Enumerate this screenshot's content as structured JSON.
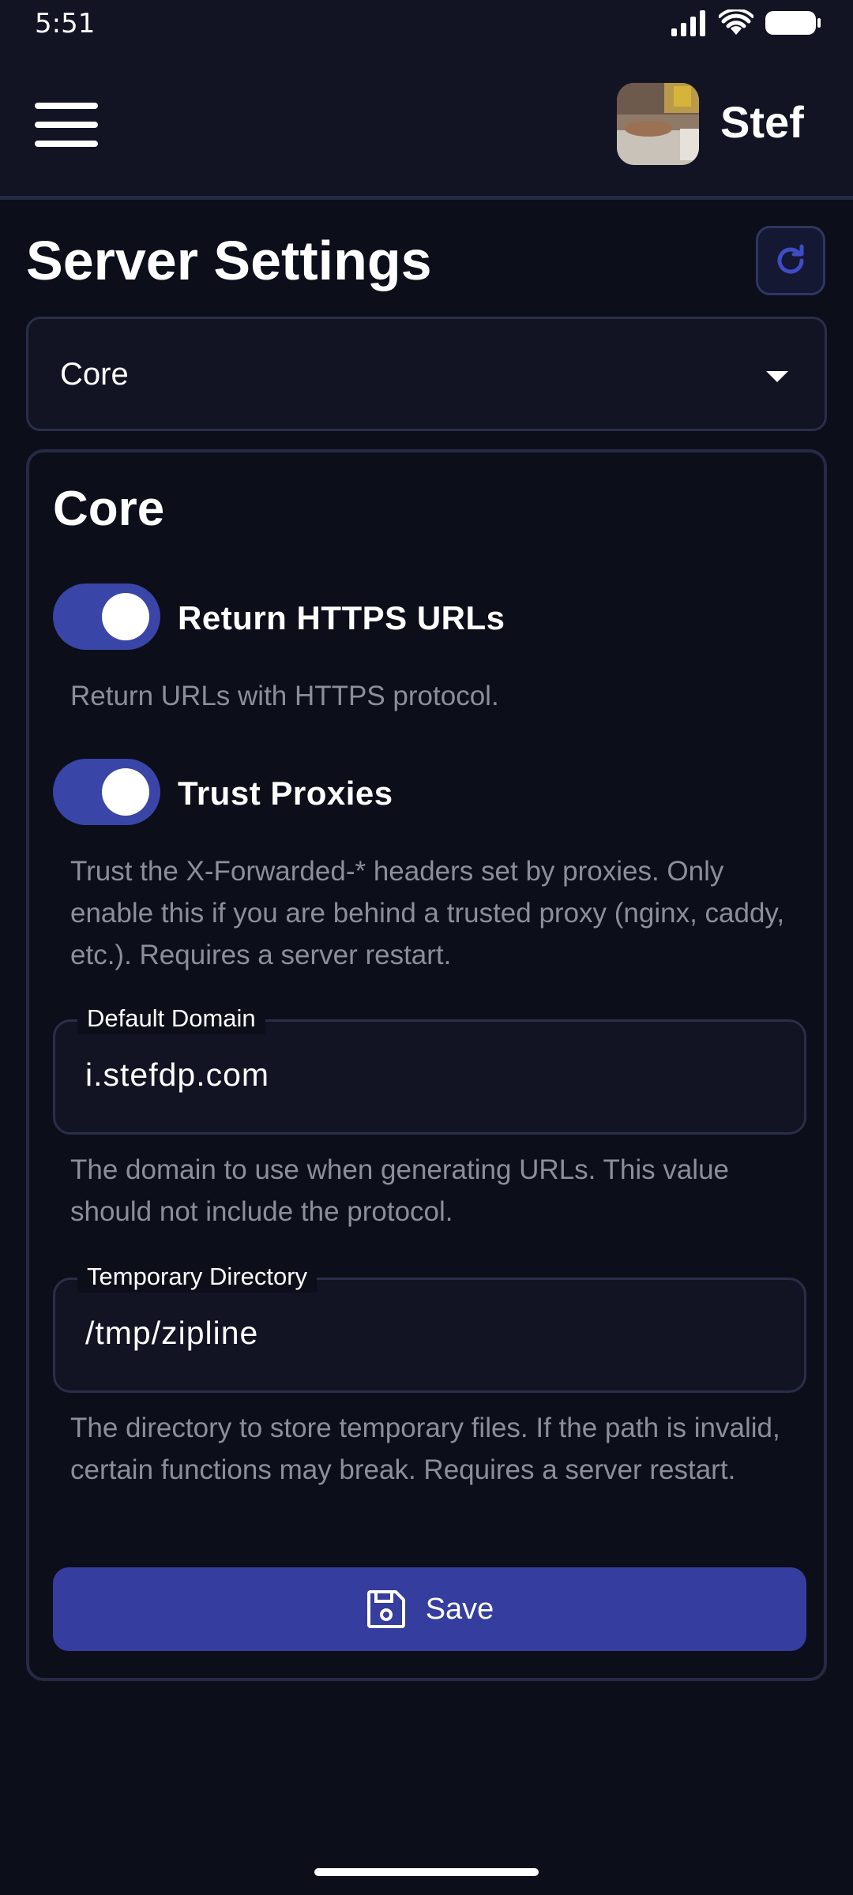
{
  "status_bar": {
    "time": "5:51"
  },
  "header": {
    "username": "Stef"
  },
  "page": {
    "title": "Server Settings"
  },
  "category_select": {
    "value": "Core"
  },
  "card": {
    "title": "Core",
    "toggles": [
      {
        "label": "Return HTTPS URLs",
        "enabled": true,
        "description": "Return URLs with HTTPS protocol."
      },
      {
        "label": "Trust Proxies",
        "enabled": true,
        "description": "Trust the X-Forwarded-* headers set by proxies. Only enable this if you are behind a trusted proxy (nginx, caddy, etc.). Requires a server restart."
      }
    ],
    "fields": [
      {
        "label": "Default Domain",
        "value": "i.stefdp.com",
        "description": "The domain to use when generating URLs. This value should not include the protocol."
      },
      {
        "label": "Temporary Directory",
        "value": "/tmp/zipline",
        "description": "The directory to store temporary files. If the path is invalid, certain functions may break. Requires a server restart."
      }
    ],
    "save_label": "Save"
  },
  "colors": {
    "background": "#0c0e1a",
    "header": "#121424",
    "accent": "#3a45a8",
    "button": "#353d9e",
    "muted_text": "#8c8e9a"
  }
}
